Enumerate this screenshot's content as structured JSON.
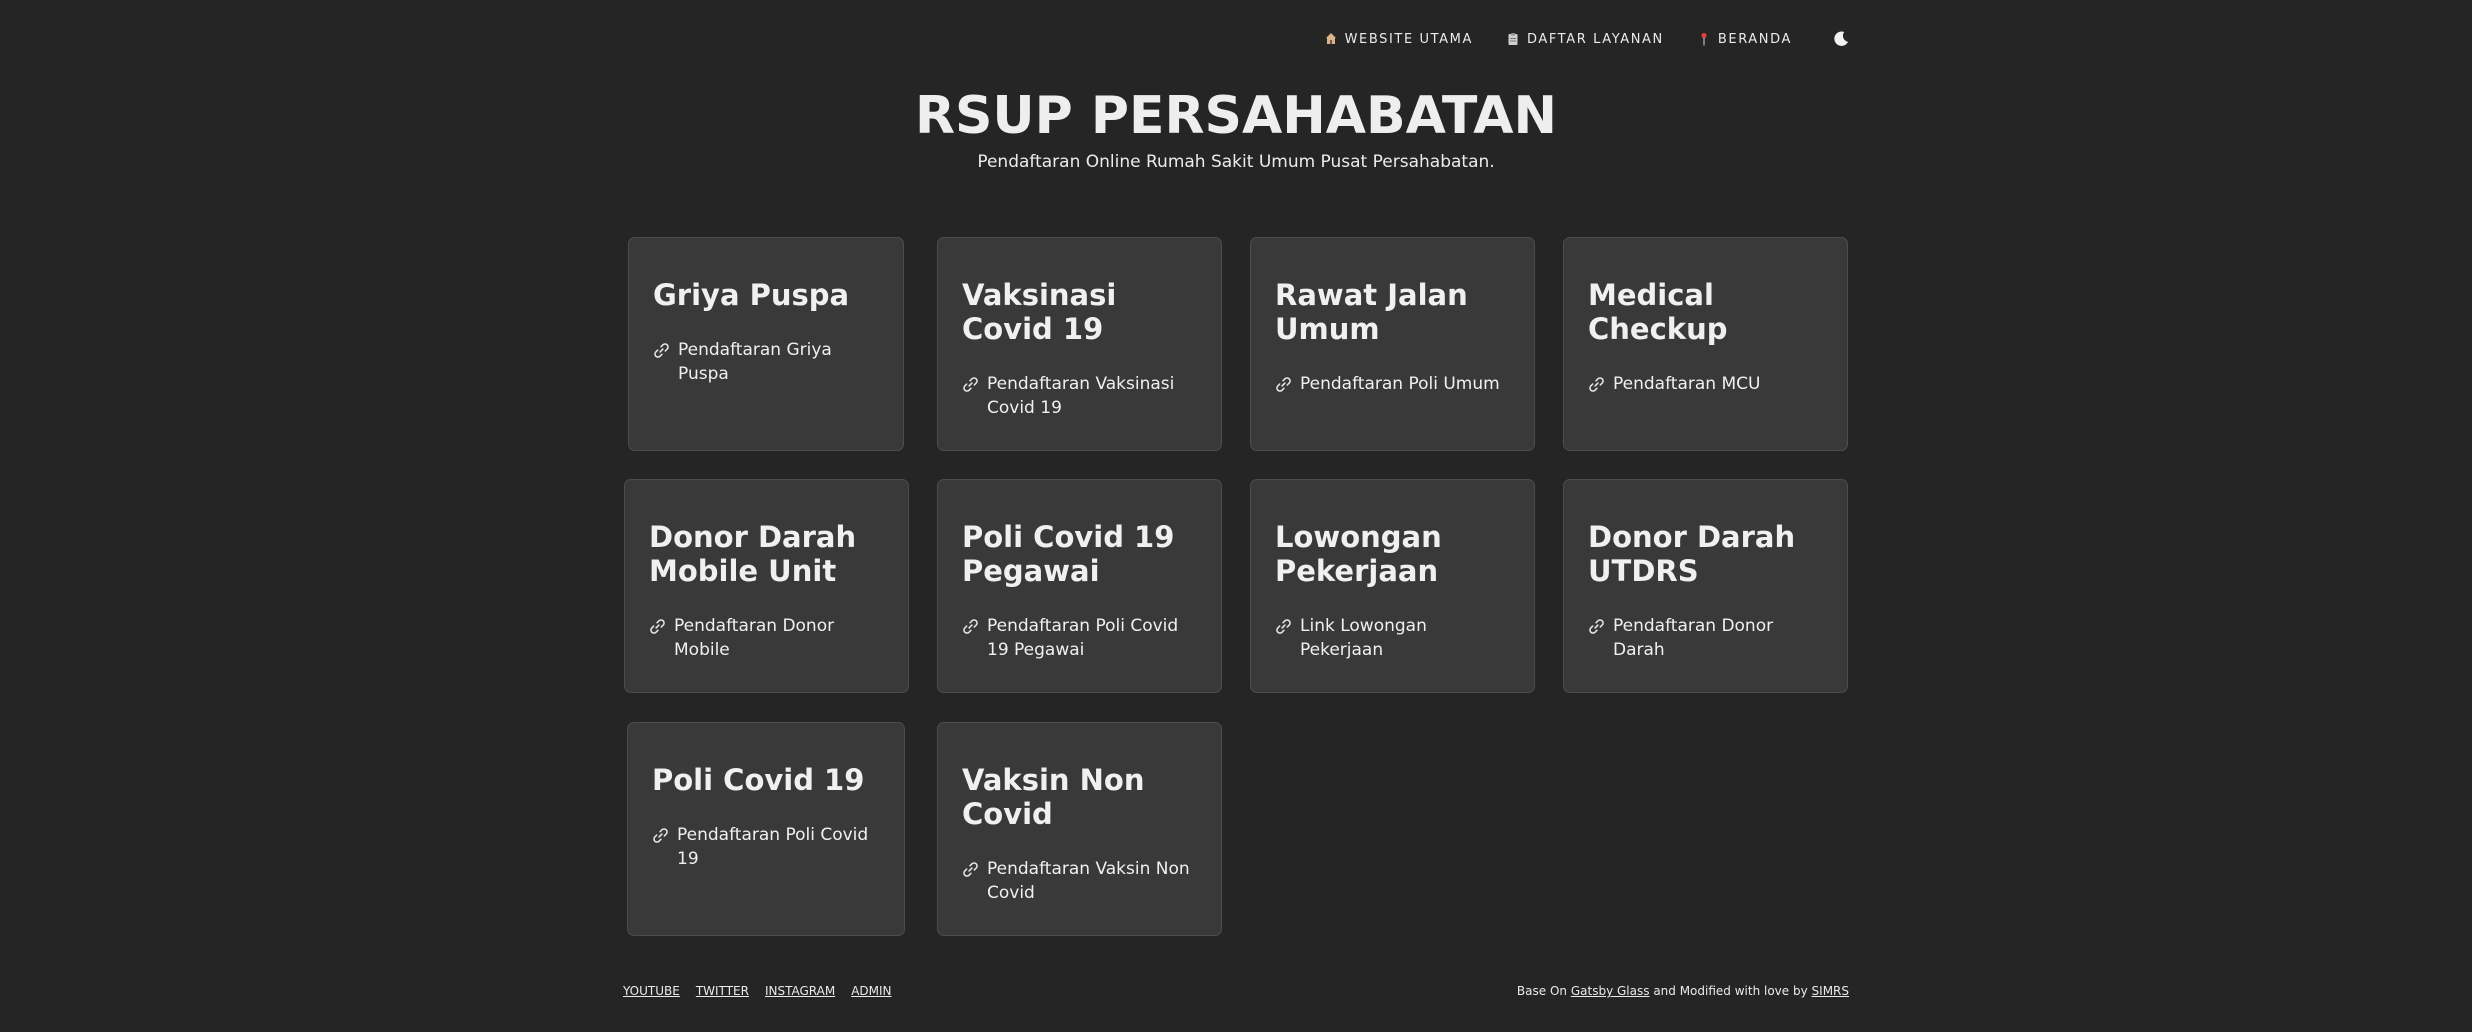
{
  "nav": {
    "items": [
      {
        "label": "WEBSITE UTAMA",
        "icon": "house-icon"
      },
      {
        "label": "DAFTAR LAYANAN",
        "icon": "clipboard-icon"
      },
      {
        "label": "BERANDA",
        "icon": "pushpin-icon"
      }
    ],
    "theme_toggle_icon": "moon-icon"
  },
  "header": {
    "title": "RSUP PERSAHABATAN",
    "subtitle": "Pendaftaran Online Rumah Sakit Umum Pusat Persahabatan."
  },
  "cards": [
    {
      "title": "Griya Puspa",
      "link": "Pendaftaran Griya Puspa"
    },
    {
      "title": "Vaksinasi Covid 19",
      "link": "Pendaftaran Vaksinasi Covid 19"
    },
    {
      "title": "Rawat Jalan Umum",
      "link": "Pendaftaran Poli Umum"
    },
    {
      "title": "Medical Checkup",
      "link": "Pendaftaran MCU"
    },
    {
      "title": "Donor Darah Mobile Unit",
      "link": "Pendaftaran Donor Mobile"
    },
    {
      "title": "Poli Covid 19 Pegawai",
      "link": "Pendaftaran Poli Covid 19 Pegawai"
    },
    {
      "title": "Lowongan Pekerjaan",
      "link": "Link Lowongan Pekerjaan"
    },
    {
      "title": "Donor Darah UTDRS",
      "link": "Pendaftaran Donor Darah"
    },
    {
      "title": "Poli Covid 19",
      "link": "Pendaftaran Poli Covid 19"
    },
    {
      "title": "Vaksin Non Covid",
      "link": "Pendaftaran Vaksin Non Covid"
    }
  ],
  "card_link_icon": "link-icon",
  "footer": {
    "links": [
      "YOUTUBE",
      "TWITTER",
      "INSTAGRAM",
      "ADMIN"
    ],
    "credit_prefix": "Base On",
    "credit_link1": "Gatsby Glass",
    "credit_middle": "and Modified with love by",
    "credit_link2": "SIMRS"
  },
  "colors": {
    "background": "#252525",
    "card": "#393939",
    "pushpin": "#e23b3b"
  }
}
